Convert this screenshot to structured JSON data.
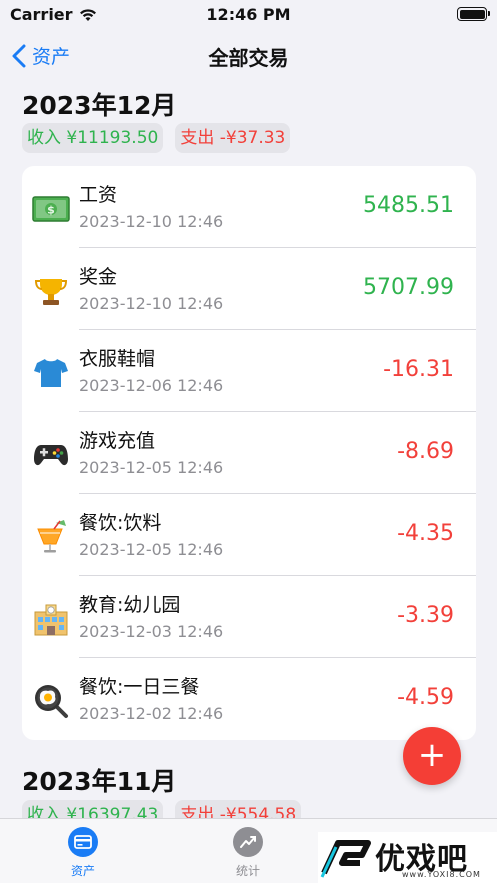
{
  "status_bar": {
    "carrier": "Carrier",
    "time": "12:46 PM"
  },
  "nav": {
    "back_label": "资产",
    "title": "全部交易"
  },
  "months": [
    {
      "title": "2023年12月",
      "income": "收入 ¥11193.50",
      "expense": "支出 -¥37.33",
      "transactions": [
        {
          "name": "工资",
          "date": "2023-12-10 12:46",
          "amount": "5485.51",
          "sign": "pos",
          "icon": "money-icon"
        },
        {
          "name": "奖金",
          "date": "2023-12-10 12:46",
          "amount": "5707.99",
          "sign": "pos",
          "icon": "trophy-icon"
        },
        {
          "name": "衣服鞋帽",
          "date": "2023-12-06 12:46",
          "amount": "-16.31",
          "sign": "neg",
          "icon": "tshirt-icon"
        },
        {
          "name": "游戏充值",
          "date": "2023-12-05 12:46",
          "amount": "-8.69",
          "sign": "neg",
          "icon": "gamepad-icon"
        },
        {
          "name": "餐饮:饮料",
          "date": "2023-12-05 12:46",
          "amount": "-4.35",
          "sign": "neg",
          "icon": "drink-icon"
        },
        {
          "name": "教育:幼儿园",
          "date": "2023-12-03 12:46",
          "amount": "-3.39",
          "sign": "neg",
          "icon": "school-icon"
        },
        {
          "name": "餐饮:一日三餐",
          "date": "2023-12-02 12:46",
          "amount": "-4.59",
          "sign": "neg",
          "icon": "frying-pan-icon"
        }
      ]
    },
    {
      "title": "2023年11月",
      "income": "收入 ¥16397.43",
      "expense": "支出 -¥554.58"
    }
  ],
  "fab": {
    "label": "+"
  },
  "tabs": [
    {
      "label": "资产",
      "icon": "card-icon",
      "active": true
    },
    {
      "label": "统计",
      "icon": "chart-icon",
      "active": false
    }
  ],
  "watermark": {
    "text": "优戏吧",
    "sub": "www.YOXI8.COM"
  },
  "colors": {
    "accent": "#1a7cf5",
    "income": "#2fb34e",
    "expense": "#f2403a",
    "fab": "#f43e36"
  }
}
